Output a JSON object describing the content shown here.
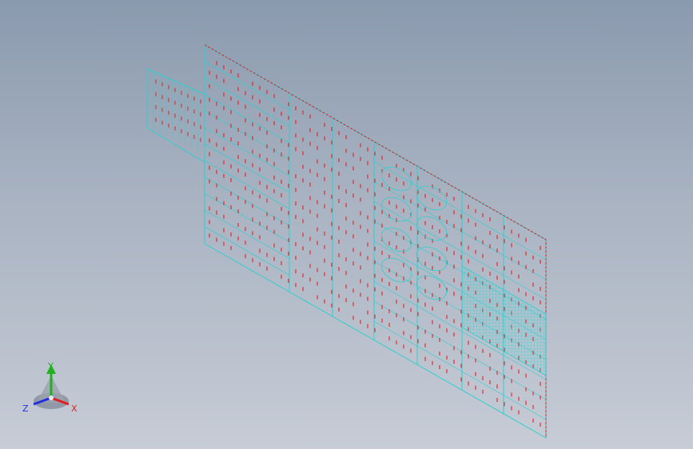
{
  "viewport": {
    "background_top": "#8a9aae",
    "background_bottom": "#c7ccd6",
    "edge_color": "#2fcfcf",
    "cut_color": "#e02020",
    "render_mode": "wireframe"
  },
  "triad": {
    "x_label": "X",
    "y_label": "Y",
    "z_label": "Z",
    "x_color": "#e02020",
    "y_color": "#20b020",
    "z_color": "#2030e0"
  }
}
